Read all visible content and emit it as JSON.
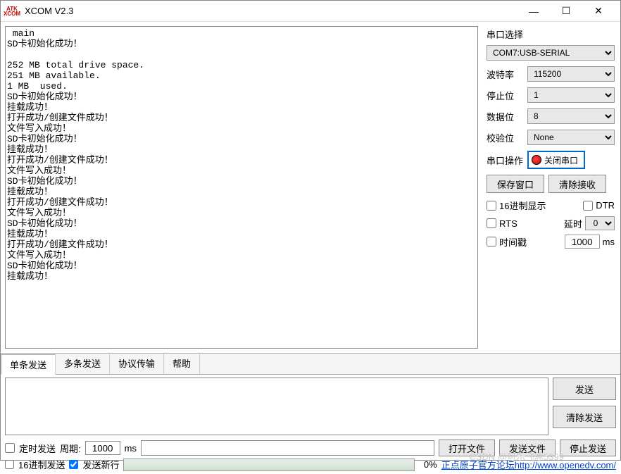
{
  "window": {
    "logo_top": "ATK",
    "logo_bot": "XCOM",
    "title": "XCOM V2.3"
  },
  "output_text": " main\nSD卡初始化成功！\n\n252 MB total drive space.\n251 MB available.\n1 MB  used.\nSD卡初始化成功！\n挂载成功！\n打开成功/创建文件成功！\n文件写入成功！\nSD卡初始化成功！\n挂载成功！\n打开成功/创建文件成功！\n文件写入成功！\nSD卡初始化成功！\n挂载成功！\n打开成功/创建文件成功！\n文件写入成功！\nSD卡初始化成功！\n挂载成功！\n打开成功/创建文件成功！\n文件写入成功！\nSD卡初始化成功！\n挂载成功！",
  "sidebar": {
    "title": "串口选择",
    "port": "COM7:USB-SERIAL",
    "baud_label": "波特率",
    "baud": "115200",
    "stop_label": "停止位",
    "stop": "1",
    "data_label": "数据位",
    "data": "8",
    "parity_label": "校验位",
    "parity": "None",
    "op_label": "串口操作",
    "op_button": "关闭串口",
    "save_button": "保存窗口",
    "clear_button": "清除接收",
    "hex_display": "16进制显示",
    "dtr": "DTR",
    "rts": "RTS",
    "delay_label": "延时",
    "delay_val": "0",
    "timestamp": "时间戳",
    "timestamp_val": "1000",
    "ms": "ms"
  },
  "tabs": {
    "t1": "单条发送",
    "t2": "多条发送",
    "t3": "协议传输",
    "t4": "帮助"
  },
  "send_buttons": {
    "send": "发送",
    "clear": "清除发送"
  },
  "bottom": {
    "timed_send": "定时发送",
    "period_label": "周期:",
    "period_val": "1000",
    "ms": "ms",
    "open_file": "打开文件",
    "send_file": "发送文件",
    "stop_send": "停止发送",
    "hex_send": "16进制发送",
    "send_newline": "发送新行",
    "pct": "0%",
    "link_text": "正点原子官方论坛http://www.openedv.com/"
  },
  "watermark": "CSDN @可乐飞冰5399"
}
